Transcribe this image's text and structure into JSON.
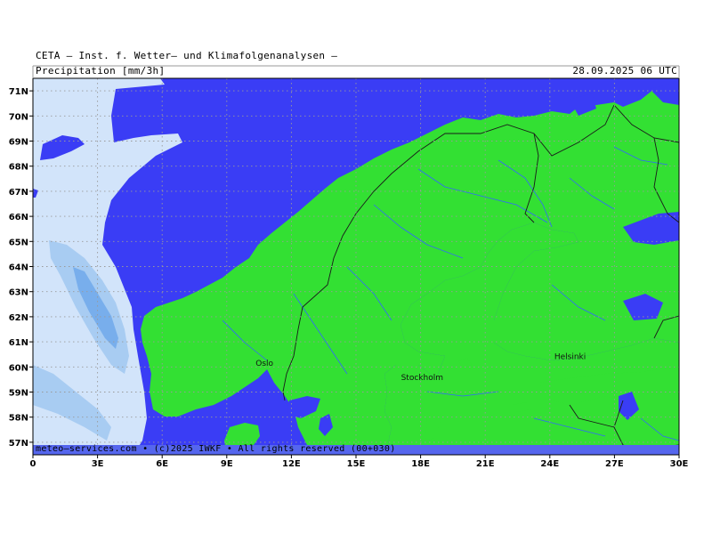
{
  "header": {
    "institute": "CETA — Inst. f. Wetter— und Klimafolgenanalysen —",
    "parameter": "Precipitation [mm/3h]",
    "valid_time": "28.09.2025 06 UTC"
  },
  "footer": {
    "credit": "meteo—services.com • (c)2025 IWKF • All rights reserved (00+030)"
  },
  "colors": {
    "sea": "#3a3df5",
    "land": "#33e033",
    "precip_light": "#d2e4fa",
    "precip_medium": "#a8ccf2",
    "precip_heavy": "#78aeec",
    "grid": "#9a9a9a",
    "rivers": "#3366ff",
    "borders": "#1a1a1a",
    "footer_band": "#5566ee"
  },
  "map": {
    "lon_range": [
      0,
      30
    ],
    "lat_range": [
      56.5,
      71.5
    ],
    "lat_labels": [
      "71N",
      "70N",
      "69N",
      "68N",
      "67N",
      "66N",
      "65N",
      "64N",
      "63N",
      "62N",
      "61N",
      "60N",
      "59N",
      "58N",
      "57N"
    ],
    "lat_values": [
      71,
      70,
      69,
      68,
      67,
      66,
      65,
      64,
      63,
      62,
      61,
      60,
      59,
      58,
      57
    ],
    "lon_labels": [
      "0",
      "3E",
      "6E",
      "9E",
      "12E",
      "15E",
      "18E",
      "21E",
      "24E",
      "27E",
      "30E"
    ],
    "lon_values": [
      0,
      3,
      6,
      9,
      12,
      15,
      18,
      21,
      24,
      27,
      30
    ],
    "cities": [
      {
        "name": "Oslo",
        "lon": 10.75,
        "lat": 59.9
      },
      {
        "name": "Stockholm",
        "lon": 18.07,
        "lat": 59.33
      },
      {
        "name": "Helsinki",
        "lon": 24.94,
        "lat": 60.17
      }
    ]
  }
}
